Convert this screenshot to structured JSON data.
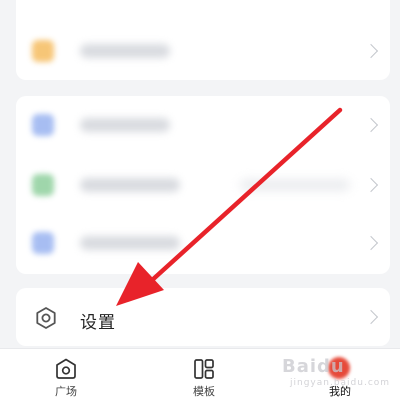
{
  "settings": {
    "label": "设置",
    "icon": "settings-hexagon-icon"
  },
  "tabbar": {
    "tabs": [
      {
        "label": "广场",
        "icon": "square-camera-icon"
      },
      {
        "label": "模板",
        "icon": "template-grid-icon"
      },
      {
        "label": "我的",
        "icon": "profile-avatar-icon"
      }
    ]
  },
  "watermark": {
    "text": "Baidu",
    "sub": "jingyan.baidu.com"
  },
  "colors": {
    "arrow": "#e8232a",
    "accent_avatar": "#e64a3a"
  }
}
